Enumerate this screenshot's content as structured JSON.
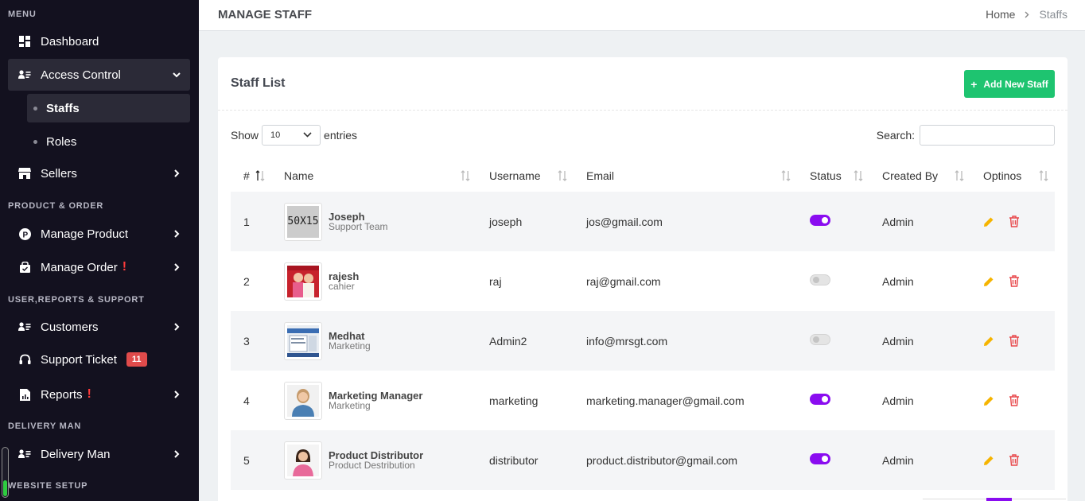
{
  "sidebar": {
    "headings": {
      "menu": "MENU",
      "product_order": "PRODUCT & ORDER",
      "user_reports": "USER,REPORTS & SUPPORT",
      "delivery": "DELIVERY MAN",
      "website": "WEBSITE SETUP"
    },
    "items": {
      "dashboard": "Dashboard",
      "access_control": "Access Control",
      "staffs": "Staffs",
      "roles": "Roles",
      "sellers": "Sellers",
      "manage_product": "Manage Product",
      "manage_order": "Manage Order",
      "customers": "Customers",
      "support_ticket": "Support Ticket",
      "support_ticket_badge": "11",
      "reports": "Reports",
      "delivery_man": "Delivery Man"
    },
    "alert_mark": "!"
  },
  "header": {
    "title": "MANAGE STAFF",
    "breadcrumb": [
      "Home",
      "Staffs"
    ]
  },
  "card": {
    "title": "Staff List",
    "add_button": "Add New Staff",
    "show_label": "Show",
    "entries_value": "10",
    "entries_label": "entries",
    "search_label": "Search:",
    "search_value": ""
  },
  "table": {
    "columns": [
      "#",
      "Name",
      "Username",
      "Email",
      "Status",
      "Created By",
      "Optinos"
    ],
    "rows": [
      {
        "num": "1",
        "name": "Joseph",
        "role": "Support Team",
        "username": "joseph",
        "email": "jos@gmail.com",
        "status": "on",
        "created_by": "Admin",
        "avatar_text": "50X15"
      },
      {
        "num": "2",
        "name": "rajesh",
        "role": "cahier",
        "username": "raj",
        "email": "raj@gmail.com",
        "status": "off",
        "created_by": "Admin"
      },
      {
        "num": "3",
        "name": "Medhat",
        "role": "Marketing",
        "username": "Admin2",
        "email": "info@mrsgt.com",
        "status": "off",
        "created_by": "Admin"
      },
      {
        "num": "4",
        "name": "Marketing Manager",
        "role": "Marketing",
        "username": "marketing",
        "email": "marketing.manager@gmail.com",
        "status": "on",
        "created_by": "Admin"
      },
      {
        "num": "5",
        "name": "Product Distributor",
        "role": "Product Destribution",
        "username": "distributor",
        "email": "product.distributor@gmail.com",
        "status": "on",
        "created_by": "Admin"
      }
    ]
  },
  "colors": {
    "sidebar_bg": "#13111f",
    "accent_green": "#1ec470",
    "toggle_on": "#8a0cf0",
    "edit_icon": "#f5b400",
    "delete_icon": "#e8474a"
  }
}
